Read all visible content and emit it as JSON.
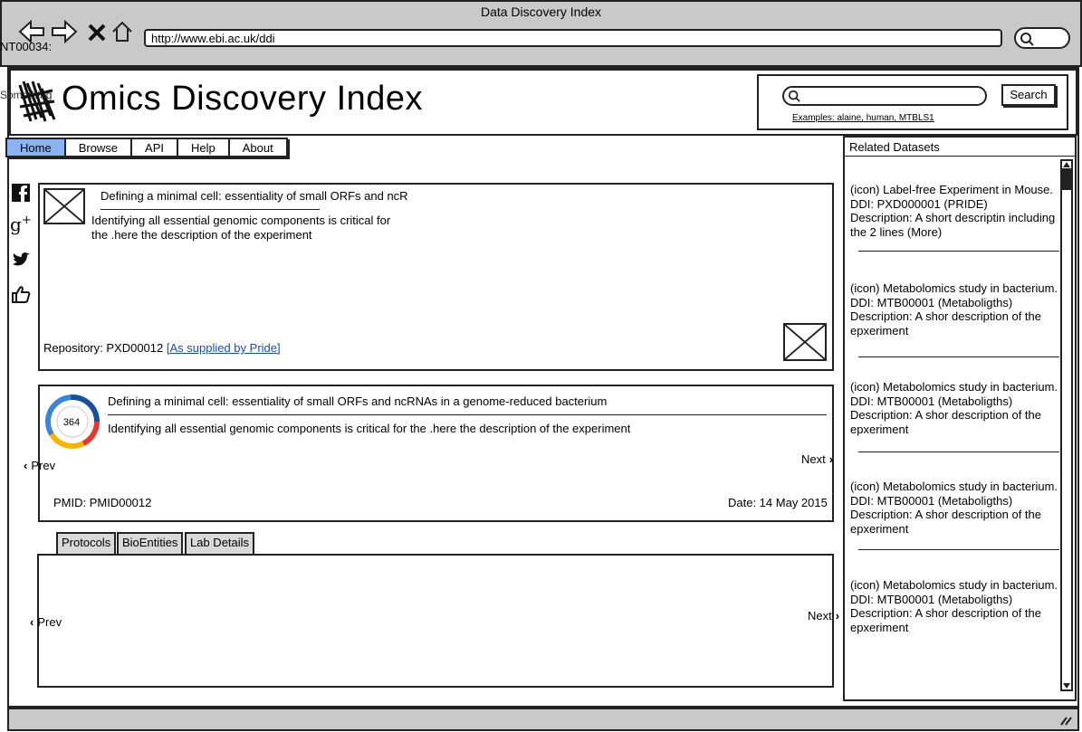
{
  "window": {
    "title": "Data Discovery Index",
    "url": "http://www.ebi.ac.uk/ddi",
    "tab_id": "NT00034:"
  },
  "header": {
    "title": "Omics Discovery Index",
    "logo_fallback": "Something",
    "search_button": "Search",
    "search_examples": "Examples: alaine, human, MTBLS1"
  },
  "nav": {
    "items": [
      "Home",
      "Browse",
      "API",
      "Help",
      "About"
    ],
    "active": "Home"
  },
  "social": [
    "facebook-icon",
    "google-plus-icon",
    "twitter-icon",
    "thumbs-up-icon"
  ],
  "card1": {
    "title": "Defining a minimal cell: essentiality of small ORFs and ncR",
    "desc_line1": "Identifying all essential genomic components is critical for",
    "desc_line2": "the .here the description of the experiment",
    "repository_label": "Repository: PXD00012",
    "repository_link": "[As supplied by Pride]"
  },
  "card2": {
    "badge": "364",
    "title": "Defining a minimal cell: essentiality of small ORFs and ncRNAs in a genome-reduced bacterium",
    "desc": "Identifying all essential genomic components is critical for the .here the description of the experiment",
    "pmid": "PMID: PMID00012",
    "date": "Date: 14 May 2015",
    "prev": "Prev",
    "next": "Next"
  },
  "tabs": [
    "Protocols",
    "BioEntities",
    "Lab Details"
  ],
  "tab_pager": {
    "prev": "Prev",
    "next": "Next"
  },
  "related": {
    "title": "Related Datasets",
    "items": [
      {
        "line1": "(icon) Label-free Experiment in Mouse.",
        "line2": "DDI: PXD000001 (PRIDE)",
        "line3": "Description: A short descriptin including",
        "line4": "the 2 lines (More)"
      },
      {
        "line1": "(icon) Metabolomics study in bacterium.",
        "line2": "DDI: MTB00001 (Metaboligths)",
        "line3": "Description: A shor description of the",
        "line4": "epxeriment"
      },
      {
        "line1": "(icon) Metabolomics study in bacterium.",
        "line2": "DDI: MTB00001 (Metaboligths)",
        "line3": "Description: A shor description of the",
        "line4": "epxeriment"
      },
      {
        "line1": "(icon) Metabolomics study in bacterium.",
        "line2": "DDI: MTB00001 (Metaboligths)",
        "line3": "Description: A shor description of the",
        "line4": "epxeriment"
      },
      {
        "line1": "(icon) Metabolomics study in bacterium.",
        "line2": "DDI: MTB00001 (Metaboligths)",
        "line3": "Description: A shor description of the",
        "line4": "epxeriment"
      }
    ]
  }
}
